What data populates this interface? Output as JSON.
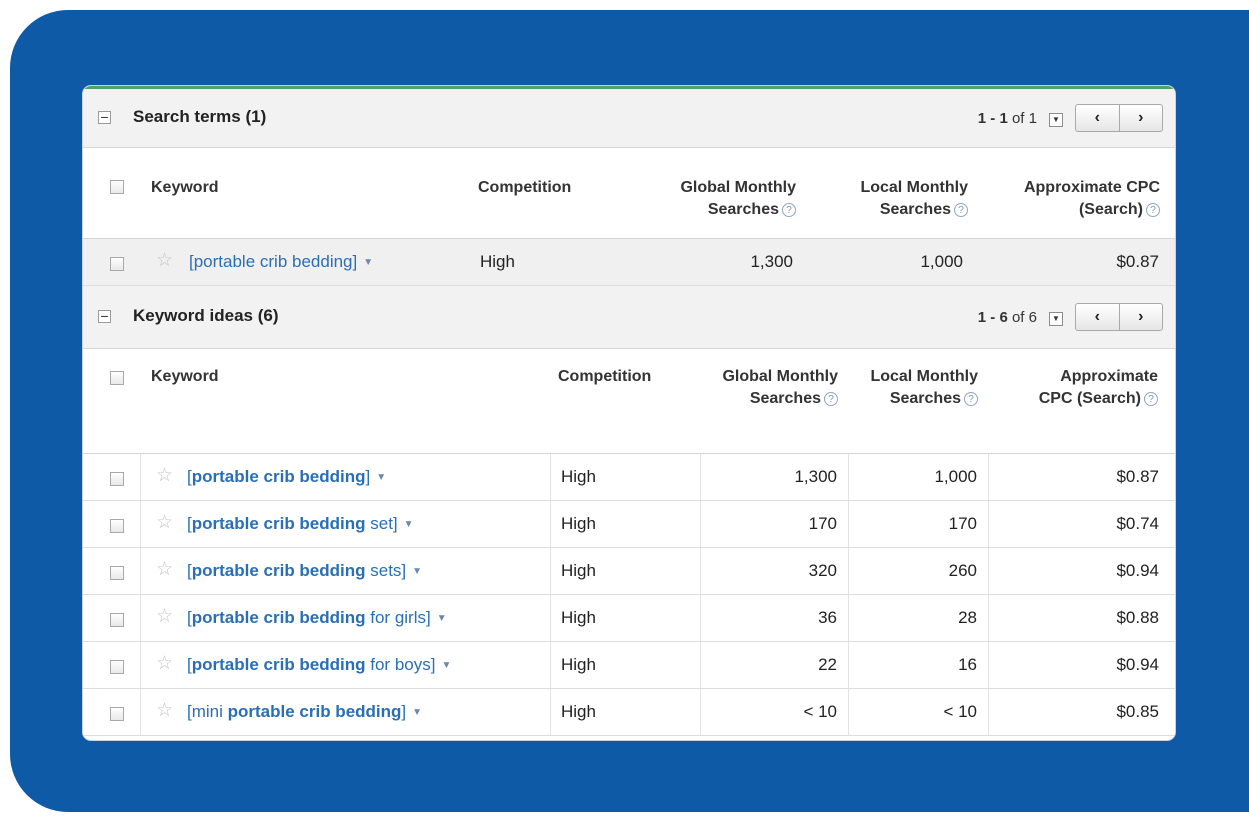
{
  "search_terms": {
    "title": "Search terms (1)",
    "pager_range": "1 - 1",
    "pager_of": "of 1",
    "prev": "‹",
    "next": "›",
    "headers": {
      "keyword": "Keyword",
      "competition": "Competition",
      "global": "Global Monthly Searches",
      "local": "Local Monthly Searches",
      "cpc": "Approximate CPC (Search)"
    },
    "rows": [
      {
        "keyword": "[portable crib bedding]",
        "competition": "High",
        "global": "1,300",
        "local": "1,000",
        "cpc": "$0.87"
      }
    ]
  },
  "keyword_ideas": {
    "title": "Keyword ideas (6)",
    "pager_range": "1 - 6",
    "pager_of": "of 6",
    "prev": "‹",
    "next": "›",
    "headers": {
      "keyword": "Keyword",
      "competition": "Competition",
      "global": "Global Monthly Searches",
      "local": "Local Monthly Searches",
      "cpc": "Approximate CPC (Search)"
    },
    "rows": [
      {
        "kw_open": "[",
        "kw_bold": "portable crib bedding",
        "kw_rest": "]",
        "competition": "High",
        "global": "1,300",
        "local": "1,000",
        "cpc": "$0.87"
      },
      {
        "kw_open": "[",
        "kw_bold": "portable crib bedding",
        "kw_rest": " set]",
        "competition": "High",
        "global": "170",
        "local": "170",
        "cpc": "$0.74"
      },
      {
        "kw_open": "[",
        "kw_bold": "portable crib bedding",
        "kw_rest": " sets]",
        "competition": "High",
        "global": "320",
        "local": "260",
        "cpc": "$0.94"
      },
      {
        "kw_open": "[",
        "kw_bold": "portable crib bedding",
        "kw_rest": " for girls]",
        "competition": "High",
        "global": "36",
        "local": "28",
        "cpc": "$0.88"
      },
      {
        "kw_open": "[",
        "kw_bold": "portable crib bedding",
        "kw_rest": " for boys]",
        "competition": "High",
        "global": "22",
        "local": "16",
        "cpc": "$0.94"
      },
      {
        "kw_open": "[mini ",
        "kw_bold": "portable crib bedding",
        "kw_rest": "]",
        "competition": "High",
        "global": "< 10",
        "local": "< 10",
        "cpc": "$0.85"
      }
    ]
  },
  "icons": {
    "collapse": "collapse-icon",
    "star": "star-icon",
    "dropdown": "dropdown-arrow-icon",
    "help": "help-icon",
    "checkbox": "checkbox"
  },
  "colors": {
    "frame": "#0e5aa7",
    "link": "#2a6fb5",
    "accent_line": "#4aa564"
  }
}
